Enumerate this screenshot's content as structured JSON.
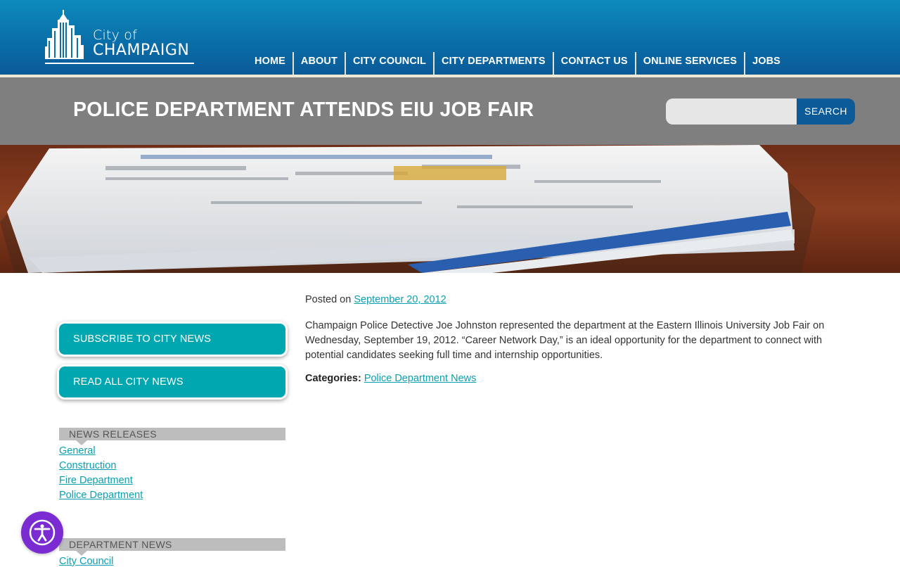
{
  "logo": {
    "line1": "City of",
    "line2": "CHAMPAIGN"
  },
  "nav": [
    "HOME",
    "ABOUT",
    "CITY COUNCIL",
    "CITY DEPARTMENTS",
    "CONTACT US",
    "ONLINE SERVICES",
    "JOBS"
  ],
  "page": {
    "title": "POLICE DEPARTMENT ATTENDS EIU JOB FAIR"
  },
  "search": {
    "button": "SEARCH",
    "placeholder": ""
  },
  "sidebar": {
    "buttons": [
      "SUBSCRIBE TO CITY NEWS",
      "READ ALL CITY NEWS"
    ],
    "news_releases": {
      "heading": "NEWS RELEASES",
      "links": [
        "General",
        "Construction",
        "Fire Department",
        "Police Department"
      ]
    },
    "department_news": {
      "heading": "DEPARTMENT NEWS",
      "links": [
        "City Council"
      ]
    }
  },
  "post": {
    "posted_prefix": "Posted on",
    "date": "September 20, 2012",
    "body": "Champaign Police Detective Joe Johnston represented the department at the Eastern Illinois University Job Fair on Wednesday, September 19, 2012. “Career Network Day,” is an ideal opportunity for the department to connect with potential candidates seeking full time and internship opportunities.",
    "categories_label": "Categories:",
    "category": "Police Department News"
  },
  "icons": {
    "accessibility": "accessibility-icon"
  },
  "colors": {
    "header": "#0a6fa9",
    "accent": "#00a7b0",
    "link": "#0aa0b2",
    "search_button": "#0c5a97",
    "accessibility": "#7a2bd1"
  }
}
